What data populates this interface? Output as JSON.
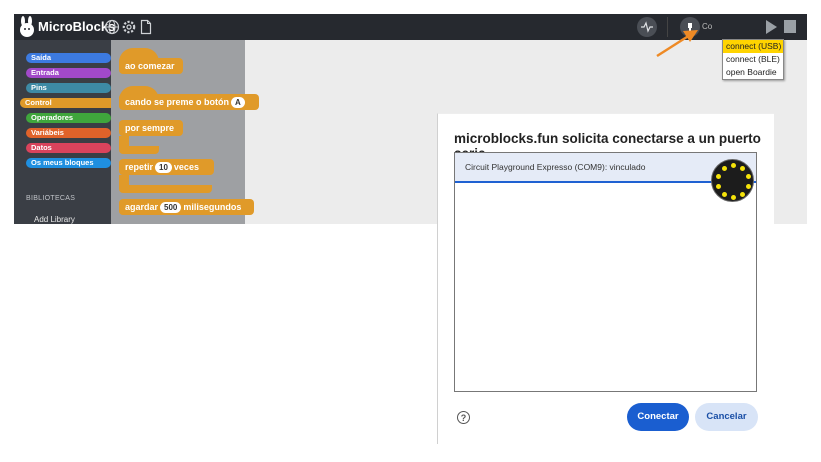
{
  "app": {
    "name": "MicroBlocks",
    "connect_label": "Co",
    "connect_menu": [
      "connect (USB)",
      "connect (BLE)",
      "open Boardie"
    ],
    "highlight_color": "#ffd400"
  },
  "palette": {
    "categories": [
      {
        "label": "Saída",
        "color": "#3c7ae0"
      },
      {
        "label": "Entrada",
        "color": "#a249c9"
      },
      {
        "label": "Pins",
        "color": "#3d8aa5"
      },
      {
        "label": "Control",
        "color": "#e09a29"
      },
      {
        "label": "Operadores",
        "color": "#3fa63c"
      },
      {
        "label": "Variábeis",
        "color": "#e0622a"
      },
      {
        "label": "Datos",
        "color": "#d9435c"
      },
      {
        "label": "Os meus bloques",
        "color": "#1f8fe0"
      }
    ],
    "section_title": "BIBLIOTECAS",
    "add_library": "Add Library"
  },
  "blocks": {
    "when_started": "ao comezar",
    "when_button": "cando se preme o botón",
    "button_value": "A",
    "forever": "por sempre",
    "repeat": "repetir",
    "repeat_count": "10",
    "repeat_suffix": "veces",
    "wait": "agardar",
    "wait_value": "500",
    "wait_unit": "milisegundos",
    "block_color": "#e09a29"
  },
  "dialog": {
    "title": "microblocks.fun solicita conectarse a un puerto serie",
    "port": "Circuit Playground Expresso (COM9): vinculado",
    "connect_button": "Conectar",
    "cancel_button": "Cancelar",
    "help": "?"
  },
  "annotation_color": "#ee8a25"
}
